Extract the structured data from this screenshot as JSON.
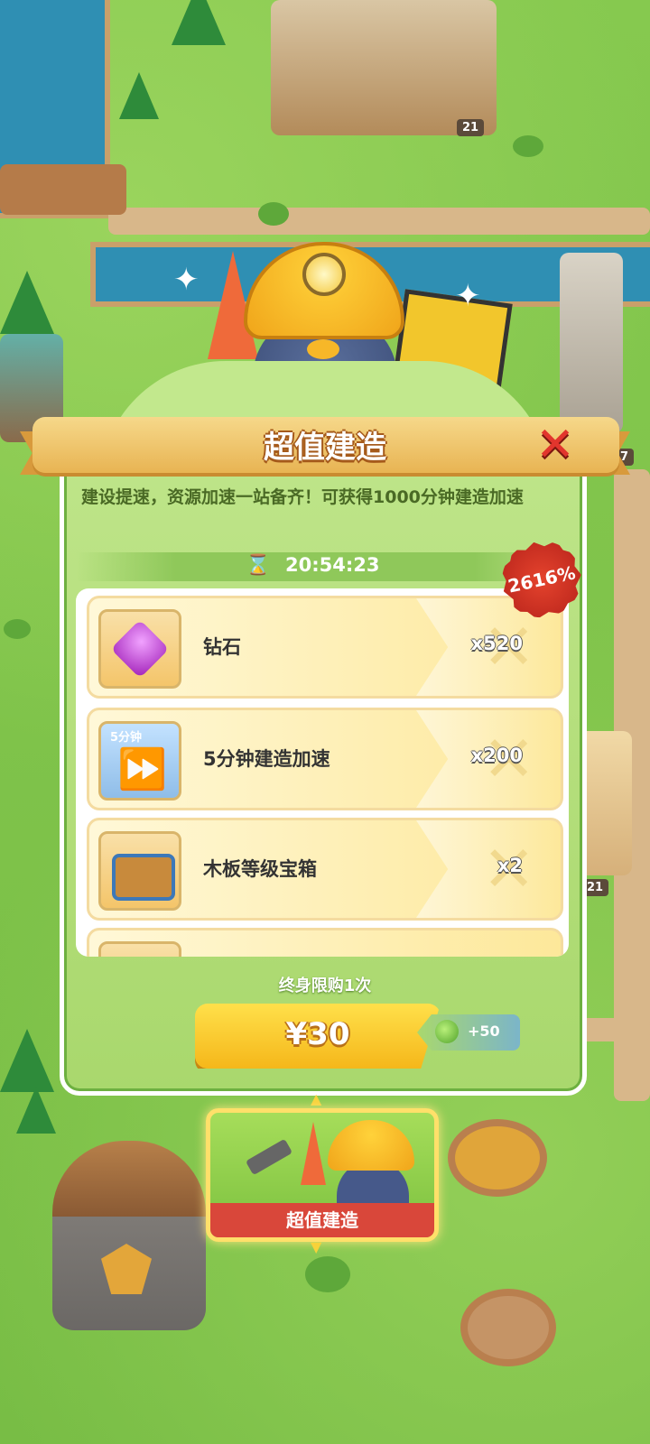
{
  "world": {
    "building_levels": [
      "21",
      "17",
      "21"
    ]
  },
  "popup": {
    "title": "超值建造",
    "close_icon": "close-x-icon",
    "description": "建设提速，资源加速一站备齐！可获得1000分钟建造加速",
    "timer_icon": "hourglass-icon",
    "timer": "20:54:23",
    "discount_badge": "2616%",
    "items": [
      {
        "icon": "diamond-gem-icon",
        "name": "钻石",
        "quantity": "x520"
      },
      {
        "icon": "build-speedup-5min-icon",
        "icon_tag": "5分钟",
        "name": "5分钟建造加速",
        "quantity": "x200"
      },
      {
        "icon": "plank-level-chest-icon",
        "name": "木板等级宝箱",
        "quantity": "x2"
      }
    ],
    "purchase_limit": "终身限购1次",
    "buy_button": {
      "label": "¥30"
    },
    "bonus": {
      "icon": "green-apple-icon",
      "label": "+50"
    }
  },
  "offer_card": {
    "label": "超值建造"
  },
  "colors": {
    "close": "#e2352d",
    "badge": "#d9473a",
    "buy_button": "#f5b71a",
    "panel_green": "#a9d86d"
  }
}
